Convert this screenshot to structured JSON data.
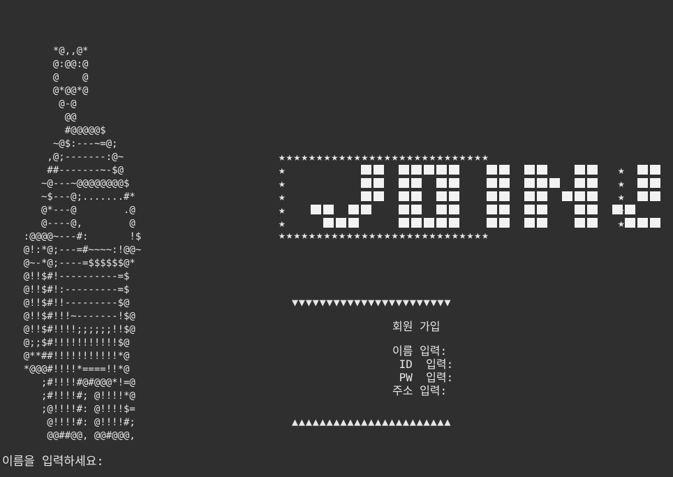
{
  "terminal": {
    "background": "#2f2f2f",
    "foreground": "#e6e6e6",
    "ascii_art": [
      "         *@,,@*",
      "         @:@@:@",
      "         @    @",
      "         @*@@*@",
      "          @-@",
      "           @@",
      "           #@@@@@$",
      "         ~@$:---~=@;",
      "        ,@;-------:@~",
      "        ##-------~-$@",
      "       ~@---~@@@@@@@@$",
      "       ~$---@;.......#*",
      "       @*---@        .@",
      "       @----@,        @",
      "    :@@@@~---#:       !$",
      "    @!:*@;---=#~~~~:!@@~",
      "    @~-*@;----=$$$$$$@*",
      "    @!!$#!----------=$",
      "    @!!$#!:---------=$",
      "    @!!$#!!---------$@",
      "    @!!$#!!!~-------!$@",
      "    @!!$#!!!!;;;;;;!!$@",
      "    @;;$#!!!!!!!!!!!$@",
      "    @**##!!!!!!!!!!!*@",
      "    *@@@#!!!!*====!!*@",
      "       ;#!!!!#@#@@@*!=@",
      "       ;#!!!!#; @!!!!*@",
      "       ;@!!!!#: @!!!!$=",
      "        @!!!!#: @!!!!#;",
      "        @@##@@, @@#@@@,"
    ],
    "banner": {
      "star_glyph": "★",
      "title": "JOIN"
    },
    "triangles": {
      "top": "▼▼▼▼▼▼▼▼▼▼▼▼▼▼▼▼▼▼▼▼▼▼▼",
      "bottom": "▲▲▲▲▲▲▲▲▲▲▲▲▲▲▲▲▲▲▲▲▲▲▲"
    },
    "form": {
      "heading": "회원 가입",
      "name_label": "이름 입력:",
      "id_label": " ID  입력:",
      "pw_label": " PW  입력:",
      "address_label": "주소 입력:"
    },
    "prompt": "이름을 입력하세요:"
  }
}
